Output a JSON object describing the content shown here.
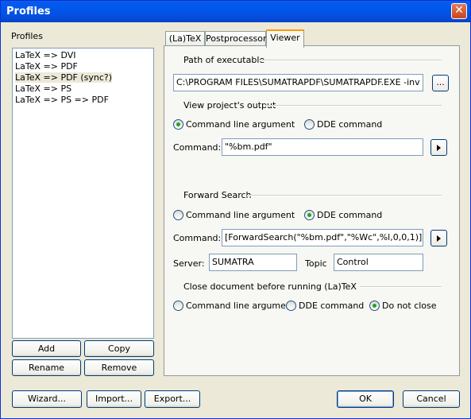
{
  "window": {
    "title": "Profiles",
    "close_glyph": "✕"
  },
  "profiles": {
    "label": "Profiles",
    "items": [
      "LaTeX => DVI",
      "LaTeX => PDF",
      "LaTeX => PDF (sync?)",
      "LaTeX => PS",
      "LaTeX => PS => PDF"
    ],
    "selected_index": 2
  },
  "profile_buttons": {
    "add": "Add",
    "copy": "Copy",
    "rename": "Rename",
    "remove": "Remove"
  },
  "tabs": [
    {
      "label": "(La)TeX",
      "active": false
    },
    {
      "label": "Postprocessor",
      "active": false
    },
    {
      "label": "Viewer",
      "active": true
    }
  ],
  "viewer": {
    "path_group": "Path of executable",
    "path_value": "C:\\PROGRAM FILES\\SUMATRAPDF\\SUMATRAPDF.EXE -inv",
    "browse_label": "...",
    "output_group": "View project's output",
    "output_options": [
      "Command line argument",
      "DDE command"
    ],
    "output_selected": 0,
    "command_label": "Command:",
    "output_command": "\"%bm.pdf\"",
    "forward_group": "Forward Search",
    "forward_options": [
      "Command line argument",
      "DDE command"
    ],
    "forward_selected": 1,
    "forward_command": "[ForwardSearch(\"%bm.pdf\",\"%Wc\",%l,0,0,1)]",
    "server_label": "Server:",
    "server_value": "SUMATRA",
    "topic_label": "Topic",
    "topic_value": "Control",
    "close_group": "Close document before running (La)TeX",
    "close_options": [
      "Command line argument",
      "DDE command",
      "Do not close"
    ],
    "close_selected": 2
  },
  "footer": {
    "wizard": "Wizard...",
    "import": "Import...",
    "export": "Export...",
    "ok": "OK",
    "cancel": "Cancel"
  },
  "colors": {
    "accent": "#0058ee",
    "radio_dot": "#21a121",
    "tab_highlight": "#ff9a00"
  },
  "icons": {
    "close": "close-icon",
    "arrow": "play-arrow-icon"
  }
}
